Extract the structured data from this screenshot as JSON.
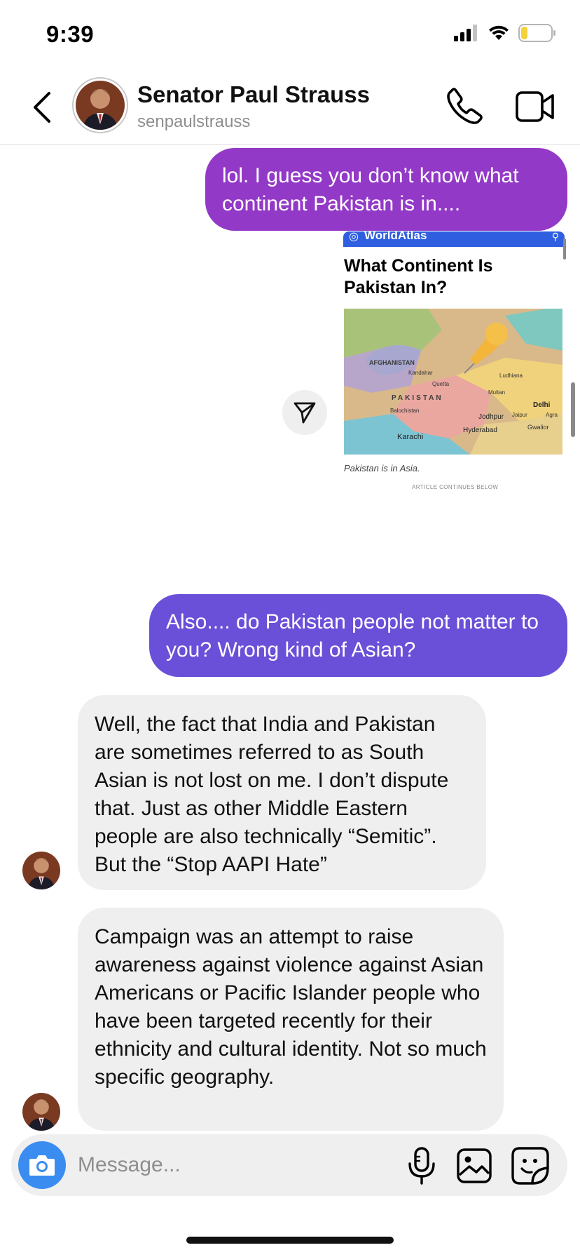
{
  "status_bar": {
    "time": "9:39"
  },
  "header": {
    "name": "Senator Paul Strauss",
    "username": "senpaulstrauss"
  },
  "messages": [
    {
      "sender": "me",
      "text": "lol. I guess you don’t know what continent Pakistan is in...."
    },
    {
      "sender": "me",
      "type": "shared_article",
      "site": "WorldAtlas",
      "title": "What Continent Is Pakistan In?",
      "map_labels": [
        "AFGHANISTAN",
        "PAKISTAN",
        "Kandahar",
        "Quetta",
        "Multan",
        "Ludhiana",
        "Delhi",
        "Agra",
        "Jaipur",
        "Jodhpur",
        "Hyderabad",
        "Karachi",
        "Gwalior",
        "Balochistan"
      ],
      "caption": "Pakistan is in Asia.",
      "footer": "ARTICLE CONTINUES BELOW"
    },
    {
      "sender": "me",
      "text": "Also.... do Pakistan people not matter to you? Wrong kind of Asian?"
    },
    {
      "sender": "them",
      "text": "Well, the fact that India and Pakistan are sometimes referred to as South Asian is not lost on me.  I don’t dispute that.  Just as other Middle Eastern people are also technically “Semitic”.  But the “Stop AAPI Hate”"
    },
    {
      "sender": "them",
      "text": "Campaign was an attempt to raise awareness against violence against Asian Americans or Pacific Islander people who have been targeted recently for their ethnicity and cultural identity.  Not so much specific geography."
    }
  ],
  "composer": {
    "placeholder": "Message..."
  },
  "colors": {
    "bubble_out_1": "#9339c7",
    "bubble_out_2": "#6a4fd8",
    "bubble_in": "#efefef",
    "camera_button": "#3a8cf0",
    "article_bar": "#2f5fe0"
  },
  "icons": [
    "back-chevron-icon",
    "phone-icon",
    "video-camera-icon",
    "send-paper-plane-icon",
    "camera-icon",
    "microphone-icon",
    "gallery-icon",
    "sticker-icon",
    "signal-icon",
    "wifi-icon",
    "battery-icon"
  ]
}
